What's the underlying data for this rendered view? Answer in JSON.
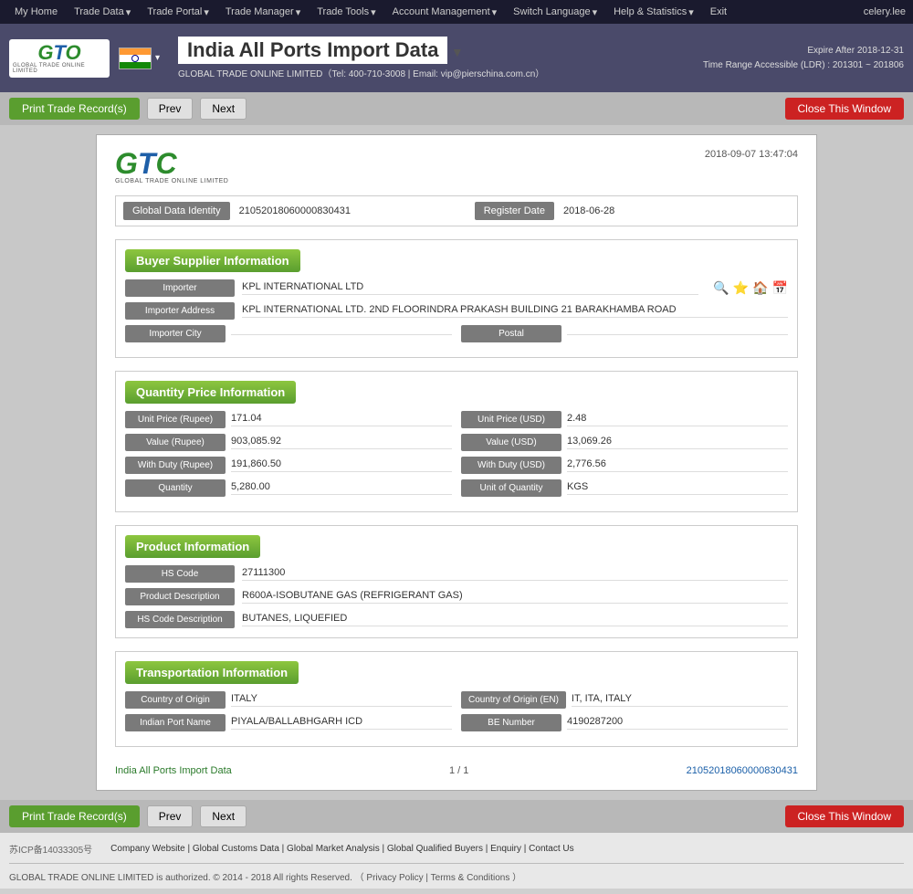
{
  "nav": {
    "items": [
      "My Home",
      "Trade Data",
      "Trade Portal",
      "Trade Manager",
      "Trade Tools",
      "Account Management",
      "Switch Language",
      "Help & Statistics",
      "Exit"
    ],
    "user": "celery.lee"
  },
  "header": {
    "logo_top": "GTC",
    "logo_subtitle": "GLOBAL TRADE ONLINE LIMITED",
    "page_title": "India All Ports Import Data",
    "page_title_dropdown": "▼",
    "contact": "GLOBAL TRADE ONLINE LIMITED（Tel: 400-710-3008 | Email: vip@pierschina.com.cn）",
    "expire": "Expire After 2018-12-31",
    "ldr": "Time Range Accessible (LDR) : 201301 ~ 201806"
  },
  "toolbar": {
    "print_label": "Print Trade Record(s)",
    "prev_label": "Prev",
    "next_label": "Next",
    "close_label": "Close This Window"
  },
  "record": {
    "timestamp": "2018-09-07  13:47:04",
    "global_data_identity_label": "Global Data Identity",
    "global_data_identity_value": "21052018060000830431",
    "register_date_label": "Register Date",
    "register_date_value": "2018-06-28",
    "section_buyer": "Buyer    Supplier Information",
    "importer_label": "Importer",
    "importer_value": "KPL INTERNATIONAL LTD",
    "importer_address_label": "Importer Address",
    "importer_address_value": "KPL INTERNATIONAL LTD. 2ND FLOORINDRA PRAKASH BUILDING 21 BARAKHAMBA ROAD",
    "importer_city_label": "Importer City",
    "importer_city_value": "",
    "postal_label": "Postal",
    "postal_value": "",
    "section_quantity": "Quantity    Price Information",
    "unit_price_rupee_label": "Unit Price (Rupee)",
    "unit_price_rupee_value": "171.04",
    "unit_price_usd_label": "Unit Price (USD)",
    "unit_price_usd_value": "2.48",
    "value_rupee_label": "Value (Rupee)",
    "value_rupee_value": "903,085.92",
    "value_usd_label": "Value (USD)",
    "value_usd_value": "13,069.26",
    "with_duty_rupee_label": "With Duty (Rupee)",
    "with_duty_rupee_value": "191,860.50",
    "with_duty_usd_label": "With Duty (USD)",
    "with_duty_usd_value": "2,776.56",
    "quantity_label": "Quantity",
    "quantity_value": "5,280.00",
    "unit_of_quantity_label": "Unit of Quantity",
    "unit_of_quantity_value": "KGS",
    "section_product": "Product Information",
    "hs_code_label": "HS Code",
    "hs_code_value": "27111300",
    "product_desc_label": "Product Description",
    "product_desc_value": "R600A-ISOBUTANE GAS (REFRIGERANT GAS)",
    "hs_code_desc_label": "HS Code Description",
    "hs_code_desc_value": "BUTANES, LIQUEFIED",
    "section_transport": "Transportation Information",
    "country_origin_label": "Country of Origin",
    "country_origin_value": "ITALY",
    "country_origin_en_label": "Country of Origin (EN)",
    "country_origin_en_value": "IT, ITA, ITALY",
    "indian_port_label": "Indian Port Name",
    "indian_port_value": "PIYALA/BALLABHGARH ICD",
    "be_number_label": "BE Number",
    "be_number_value": "4190287200",
    "footer_link": "India All Ports Import Data",
    "footer_page": "1 / 1",
    "footer_id": "21052018060000830431"
  },
  "site_footer": {
    "icp": "苏ICP备14033305号",
    "links": "Company Website | Global Customs Data | Global Market Analysis | Global Qualified Buyers | Enquiry | Contact Us",
    "copyright": "GLOBAL TRADE ONLINE LIMITED is authorized. © 2014 - 2018 All rights Reserved.  （ Privacy Policy | Terms & Conditions ）"
  }
}
